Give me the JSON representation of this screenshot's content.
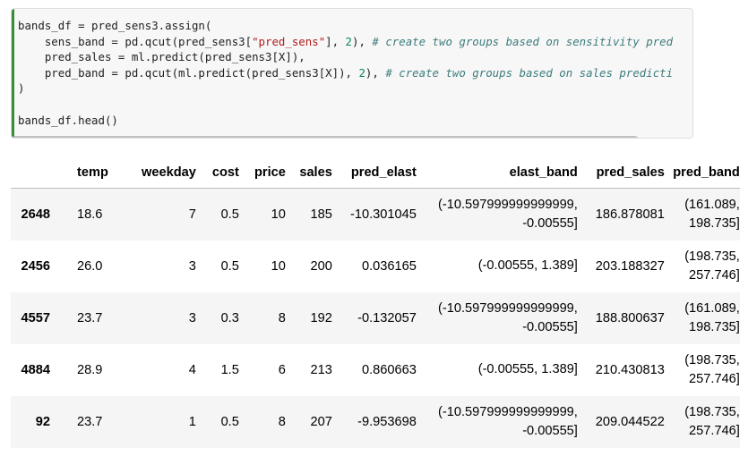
{
  "code_cell": {
    "lines": [
      [
        {
          "t": "bands_df = pred_sens3.assign("
        }
      ],
      [
        {
          "t": "    sens_band = pd.qcut(pred_sens3["
        },
        {
          "t": "\"pred_sens\"",
          "c": "str"
        },
        {
          "t": "], "
        },
        {
          "t": "2",
          "c": "num"
        },
        {
          "t": "), "
        },
        {
          "t": "# create two groups based on sensitivity pred",
          "c": "cmt"
        }
      ],
      [
        {
          "t": "    pred_sales = ml.predict(pred_sens3[X]),"
        }
      ],
      [
        {
          "t": "    pred_band = pd.qcut(ml.predict(pred_sens3[X]), "
        },
        {
          "t": "2",
          "c": "num"
        },
        {
          "t": "), "
        },
        {
          "t": "# create two groups based on sales predicti",
          "c": "cmt"
        }
      ],
      [
        {
          "t": ")"
        }
      ],
      [
        {
          "t": ""
        }
      ],
      [
        {
          "t": "bands_df.head()"
        }
      ]
    ]
  },
  "table": {
    "headers": [
      "",
      "temp",
      "weekday",
      "cost",
      "price",
      "sales",
      "pred_elast",
      "elast_band",
      "pred_sales",
      "pred_band"
    ],
    "rows": [
      {
        "index": "2648",
        "temp": "18.6",
        "weekday": "7",
        "cost": "0.5",
        "price": "10",
        "sales": "185",
        "pred_elast": "-10.301045",
        "elast_band": [
          "(-10.597999999999999,",
          "-0.00555]"
        ],
        "pred_sales": "186.878081",
        "pred_band": [
          "(161.089,",
          "198.735]"
        ]
      },
      {
        "index": "2456",
        "temp": "26.0",
        "weekday": "3",
        "cost": "0.5",
        "price": "10",
        "sales": "200",
        "pred_elast": "0.036165",
        "elast_band": [
          "(-0.00555, 1.389]"
        ],
        "pred_sales": "203.188327",
        "pred_band": [
          "(198.735,",
          "257.746]"
        ]
      },
      {
        "index": "4557",
        "temp": "23.7",
        "weekday": "3",
        "cost": "0.3",
        "price": "8",
        "sales": "192",
        "pred_elast": "-0.132057",
        "elast_band": [
          "(-10.597999999999999,",
          "-0.00555]"
        ],
        "pred_sales": "188.800637",
        "pred_band": [
          "(161.089,",
          "198.735]"
        ]
      },
      {
        "index": "4884",
        "temp": "28.9",
        "weekday": "4",
        "cost": "1.5",
        "price": "6",
        "sales": "213",
        "pred_elast": "0.860663",
        "elast_band": [
          "(-0.00555, 1.389]"
        ],
        "pred_sales": "210.430813",
        "pred_band": [
          "(198.735,",
          "257.746]"
        ]
      },
      {
        "index": "92",
        "temp": "23.7",
        "weekday": "1",
        "cost": "0.5",
        "price": "8",
        "sales": "207",
        "pred_elast": "-9.953698",
        "elast_band": [
          "(-10.597999999999999,",
          "-0.00555]"
        ],
        "pred_sales": "209.044522",
        "pred_band": [
          "(198.735,",
          "257.746]"
        ]
      }
    ]
  }
}
